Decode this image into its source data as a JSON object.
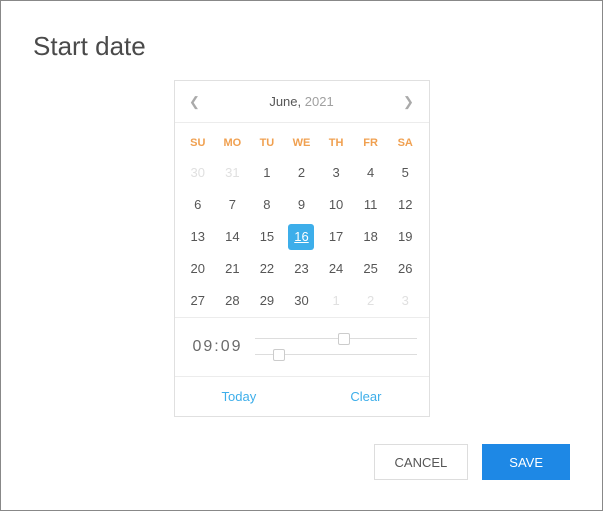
{
  "dialog": {
    "title": "Start date"
  },
  "picker": {
    "month": "June,",
    "year": "2021",
    "dow": [
      "SU",
      "MO",
      "TU",
      "WE",
      "TH",
      "FR",
      "SA"
    ],
    "weeks": [
      [
        {
          "d": "30",
          "out": true
        },
        {
          "d": "31",
          "out": true
        },
        {
          "d": "1"
        },
        {
          "d": "2"
        },
        {
          "d": "3"
        },
        {
          "d": "4"
        },
        {
          "d": "5"
        }
      ],
      [
        {
          "d": "6"
        },
        {
          "d": "7"
        },
        {
          "d": "8"
        },
        {
          "d": "9"
        },
        {
          "d": "10"
        },
        {
          "d": "11"
        },
        {
          "d": "12"
        }
      ],
      [
        {
          "d": "13"
        },
        {
          "d": "14"
        },
        {
          "d": "15"
        },
        {
          "d": "16",
          "selected": true
        },
        {
          "d": "17"
        },
        {
          "d": "18"
        },
        {
          "d": "19"
        }
      ],
      [
        {
          "d": "20"
        },
        {
          "d": "21"
        },
        {
          "d": "22"
        },
        {
          "d": "23"
        },
        {
          "d": "24"
        },
        {
          "d": "25"
        },
        {
          "d": "26"
        }
      ],
      [
        {
          "d": "27"
        },
        {
          "d": "28"
        },
        {
          "d": "29"
        },
        {
          "d": "30"
        },
        {
          "d": "1",
          "out": true
        },
        {
          "d": "2",
          "out": true
        },
        {
          "d": "3",
          "out": true
        }
      ]
    ],
    "time": {
      "display": "09:09",
      "hour_pct": 55,
      "min_pct": 15
    },
    "today_label": "Today",
    "clear_label": "Clear"
  },
  "actions": {
    "cancel": "CANCEL",
    "save": "SAVE"
  }
}
